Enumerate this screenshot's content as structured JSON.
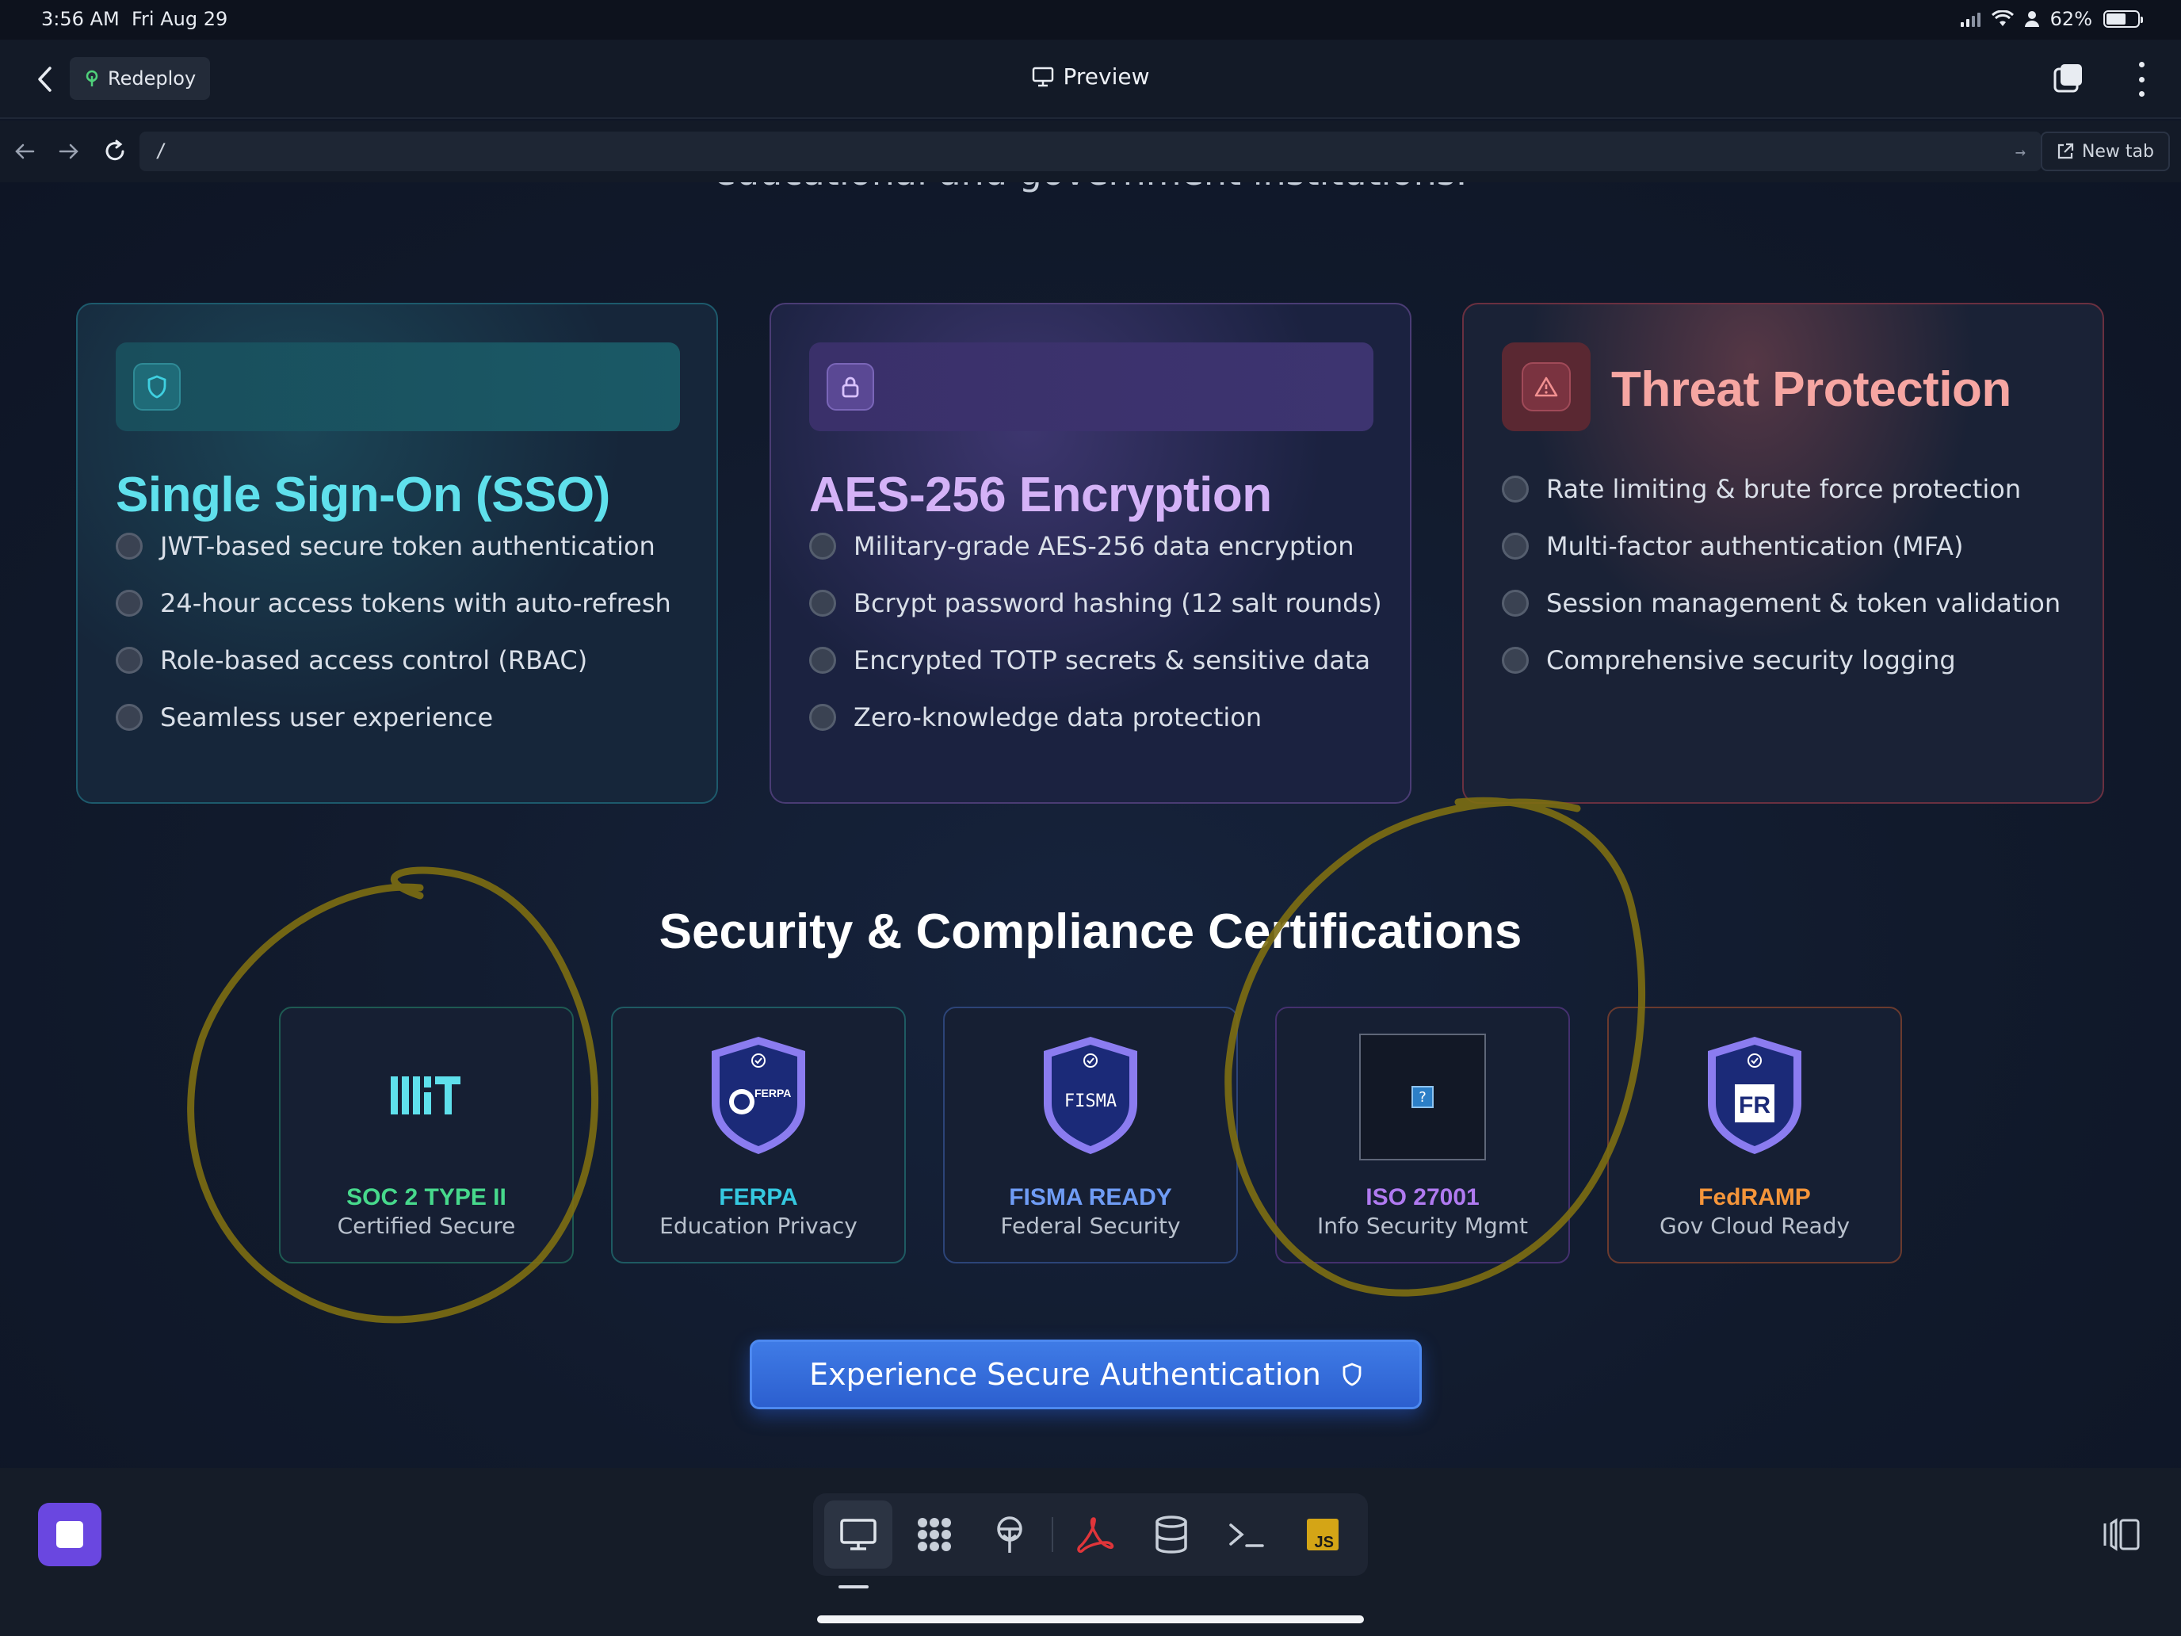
{
  "status": {
    "time": "3:56 AM",
    "date": "Fri Aug 29",
    "battery": "62%",
    "battery_level": 0.62
  },
  "header": {
    "redeploy_label": "Redeploy",
    "title": "Preview"
  },
  "urlbar": {
    "url": "/",
    "new_tab_label": "New tab"
  },
  "page": {
    "intro_text": "educational and government institutions.",
    "cards": [
      {
        "title": "Single Sign-On (SSO)",
        "icon": "shield-icon",
        "accent": "#5fe0ec",
        "features": [
          "JWT-based secure token authentication",
          "24-hour access tokens with auto-refresh",
          "Role-based access control (RBAC)",
          "Seamless user experience"
        ]
      },
      {
        "title": "AES-256 Encryption",
        "icon": "lock-icon",
        "accent": "#d4b2f7",
        "features": [
          "Military-grade AES-256 data encryption",
          "Bcrypt password hashing (12 salt rounds)",
          "Encrypted TOTP secrets & sensitive data",
          "Zero-knowledge data protection"
        ]
      },
      {
        "title": "Threat Protection",
        "icon": "warning-icon",
        "accent": "#f6a6a2",
        "features": [
          "Rate limiting & brute force protection",
          "Multi-factor authentication (MFA)",
          "Session management & token validation",
          "Comprehensive security logging"
        ]
      }
    ],
    "certifications_title": "Security & Compliance Certifications",
    "certifications": [
      {
        "name": "SOC 2 TYPE II",
        "subtitle": "Certified Secure",
        "logo": "mit-logo",
        "color": "#47d98c"
      },
      {
        "name": "FERPA",
        "subtitle": "Education Privacy",
        "logo": "ferpa-shield",
        "badge_text": "FERPA",
        "color": "#35c8e0"
      },
      {
        "name": "FISMA READY",
        "subtitle": "Federal Security",
        "logo": "fisma-shield",
        "badge_text": "FISMA",
        "color": "#6f9cf5"
      },
      {
        "name": "ISO 27001",
        "subtitle": "Info Security Mgmt",
        "logo": "broken-image-icon",
        "color": "#b07af0"
      },
      {
        "name": "FedRAMP",
        "subtitle": "Gov Cloud Ready",
        "logo": "fedramp-shield",
        "badge_text": "FR",
        "color": "#f5953a"
      }
    ],
    "cta_label": "Experience Secure Authentication"
  },
  "dock": {
    "items": [
      "monitor-icon",
      "apps-grid-icon",
      "antenna-icon",
      "pdf-icon",
      "database-icon",
      "terminal-icon",
      "js-icon"
    ],
    "js_label": "JS"
  },
  "annotation_color": "#8a7a12"
}
